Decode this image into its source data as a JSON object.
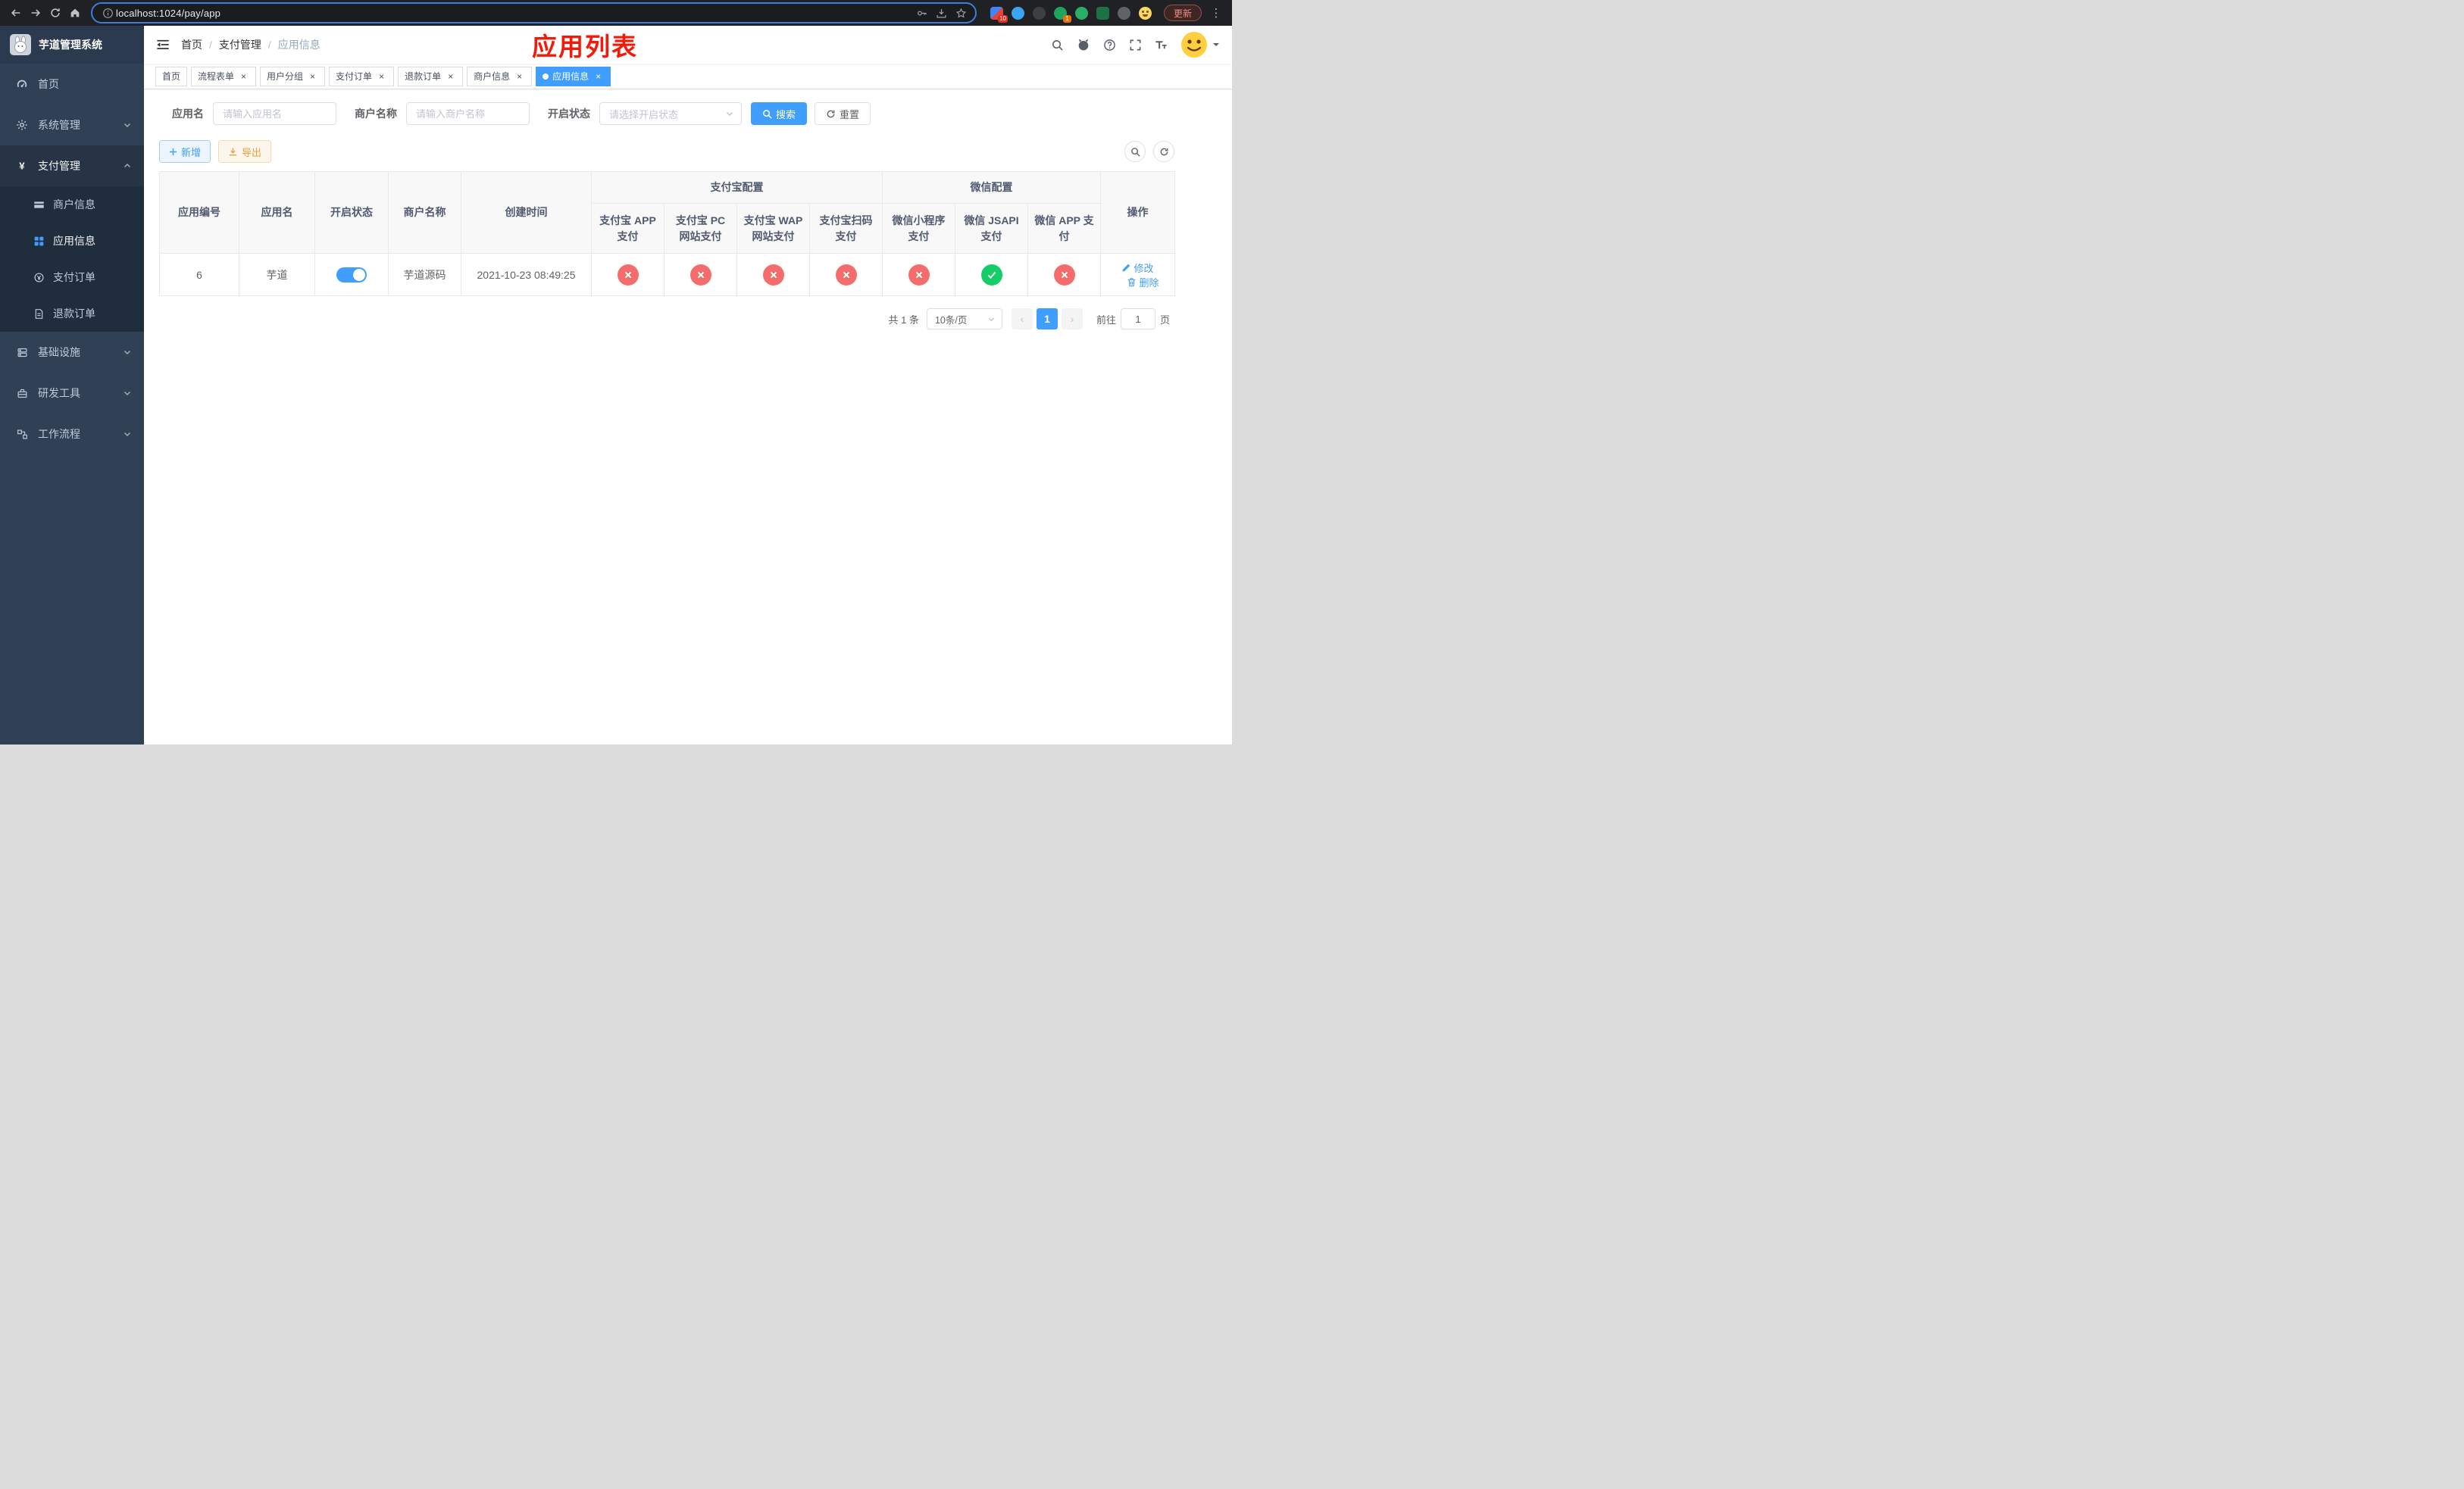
{
  "browser": {
    "url": "localhost:1024/pay/app",
    "update_label": "更新",
    "ext_badges": {
      "puzzle": "10",
      "green": "1"
    }
  },
  "sidebar": {
    "title": "芋道管理系统",
    "menu": [
      {
        "key": "home",
        "label": "首页",
        "icon": "dashboard",
        "expandable": false
      },
      {
        "key": "system",
        "label": "系统管理",
        "icon": "gear",
        "expandable": true
      },
      {
        "key": "payment",
        "label": "支付管理",
        "icon": "yen",
        "expandable": true,
        "expanded": true,
        "children": [
          {
            "key": "merchant-info",
            "label": "商户信息",
            "icon": "card"
          },
          {
            "key": "app-info",
            "label": "应用信息",
            "icon": "grid",
            "active": true
          },
          {
            "key": "payment-order",
            "label": "支付订单",
            "icon": "coin"
          },
          {
            "key": "refund-order",
            "label": "退款订单",
            "icon": "doc"
          }
        ]
      },
      {
        "key": "infrastructure",
        "label": "基础设施",
        "icon": "infra",
        "expandable": true
      },
      {
        "key": "dev-tools",
        "label": "研发工具",
        "icon": "tools",
        "expandable": true
      },
      {
        "key": "workflow",
        "label": "工作流程",
        "icon": "flow",
        "expandable": true
      }
    ]
  },
  "header": {
    "breadcrumb": [
      "首页",
      "支付管理",
      "应用信息"
    ],
    "annotation": "应用列表"
  },
  "tabs": [
    {
      "key": "home",
      "label": "首页",
      "closable": false,
      "active": false
    },
    {
      "key": "flow-form",
      "label": "流程表单",
      "closable": true,
      "active": false
    },
    {
      "key": "user-group",
      "label": "用户分组",
      "closable": true,
      "active": false
    },
    {
      "key": "payment-order",
      "label": "支付订单",
      "closable": true,
      "active": false
    },
    {
      "key": "refund-order",
      "label": "退款订单",
      "closable": true,
      "active": false
    },
    {
      "key": "merchant-info",
      "label": "商户信息",
      "closable": true,
      "active": false
    },
    {
      "key": "app-info",
      "label": "应用信息",
      "closable": true,
      "active": true
    }
  ],
  "filters": {
    "app_name_label": "应用名",
    "app_name_placeholder": "请输入应用名",
    "merchant_label": "商户名称",
    "merchant_placeholder": "请输入商户名称",
    "status_label": "开启状态",
    "status_placeholder": "请选择开启状态",
    "search_button": "搜索",
    "reset_button": "重置"
  },
  "toolbar": {
    "add_button": "新增",
    "export_button": "导出"
  },
  "table": {
    "group_headers": {
      "alipay": "支付宝配置",
      "wechat": "微信配置"
    },
    "columns": [
      "应用编号",
      "应用名",
      "开启状态",
      "商户名称",
      "创建时间",
      "支付宝 APP 支付",
      "支付宝 PC 网站支付",
      "支付宝 WAP 网站支付",
      "支付宝扫码支付",
      "微信小程序支付",
      "微信 JSAPI 支付",
      "微信 APP 支付",
      "操作"
    ],
    "rows": [
      {
        "id": "6",
        "name": "芋道",
        "status_on": true,
        "merchant": "芋道源码",
        "created": "2021-10-23 08:49:25",
        "configs": [
          false,
          false,
          false,
          false,
          false,
          true,
          false
        ],
        "actions": [
          "修改",
          "删除"
        ]
      }
    ]
  },
  "pagination": {
    "total_label": "共 1 条",
    "page_size": "10条/页",
    "current_page": "1",
    "goto_prefix": "前往",
    "goto_value": "1",
    "goto_suffix": "页"
  },
  "colors": {
    "primary": "#409eff",
    "success": "#13ce66",
    "danger": "#f56c6c",
    "warning": "#e6a23c",
    "annotation": "#f5190a",
    "sidebar_bg": "#304156",
    "submenu_bg": "#1f2d3d"
  }
}
